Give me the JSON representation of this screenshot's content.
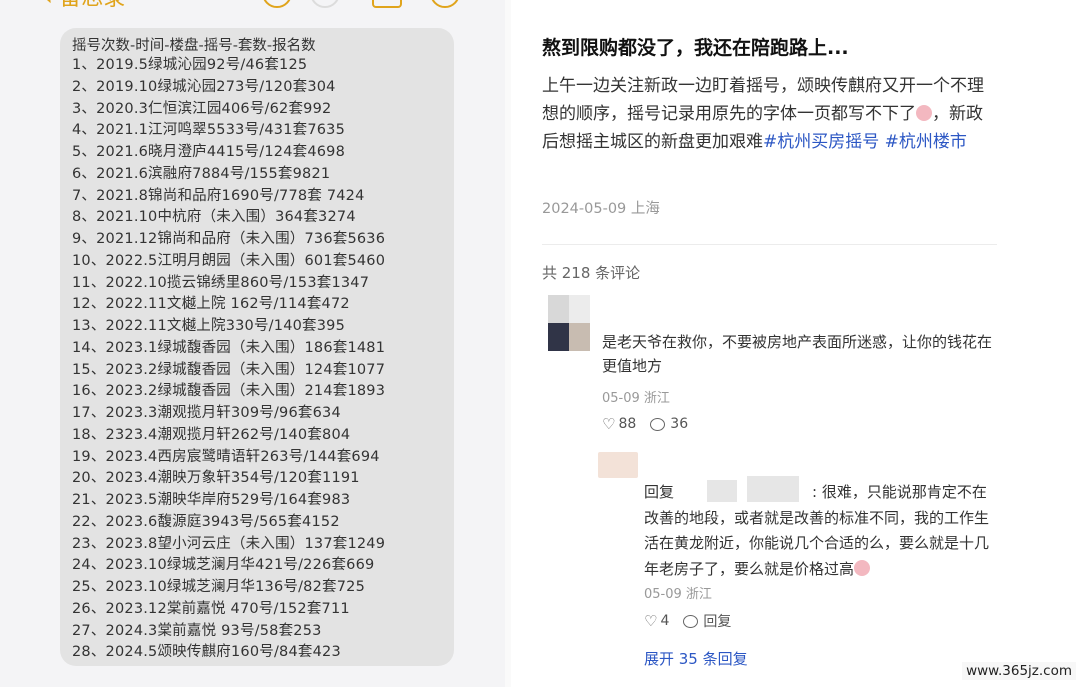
{
  "left_app": {
    "back_label": "备忘录",
    "note": {
      "header": "摇号次数-时间-楼盘-摇号-套数-报名数",
      "lines": [
        "1、2019.5绿城沁园92号/46套125",
        "2、2019.10绿城沁园273号/120套304",
        "3、2020.3仁恒滨江园406号/62套992",
        "4、2021.1江河鸣翠5533号/431套7635",
        "5、2021.6晓月澄庐4415号/124套4698",
        "6、2021.6滨融府7884号/155套9821",
        "7、2021.8锦尚和品府1690号/778套 7424",
        "8、2021.10中杭府（未入围）364套3274",
        "9、2021.12锦尚和品府（未入围）736套5636",
        "10、2022.5江明月朗园（未入围）601套5460",
        "11、2022.10揽云锦绣里860号/153套1347",
        "12、2022.11文樾上院 162号/114套472",
        "13、2022.11文樾上院330号/140套395",
        "14、2023.1绿城馥香园（未入围）186套1481",
        "15、2023.2绿城馥香园（未入围）124套1077",
        "16、2023.2绿城馥香园（未入围）214套1893",
        "17、2023.3潮观揽月轩309号/96套634",
        "18、2323.4潮观揽月轩262号/140套804",
        "19、2023.4西房宸鹭晴语轩263号/144套694",
        "20、2023.4潮映万象轩354号/120套1191",
        "21、2023.5潮映华岸府529号/164套983",
        "22、2023.6馥源庭3943号/565套4152",
        "23、2023.8望小河云庄（未入围）137套1249",
        "24、2023.10绿城芝澜月华421号/226套669",
        "25、2023.10绿城芝澜月华136号/82套725",
        "26、2023.12棠前嘉悦 470号/152套711",
        "27、2024.3棠前嘉悦 93号/58套253",
        "28、2024.5颂映传麒府160号/84套423"
      ]
    },
    "accent_color": "#e0a41c"
  },
  "post": {
    "title": "熬到限购都没了，我还在陪跑路上...",
    "body_text": "上午一边关注新政一边盯着摇号，颂映传麒府又开一个不理想的顺序，摇号记录用原先的字体一页都写不下了",
    "body_text_2": "，新政后想摇主城区的新盘更加艰难",
    "hashtags": [
      "#杭州买房摇号",
      "#杭州楼市"
    ],
    "date": "2024-05-09",
    "location": "上海"
  },
  "comments": {
    "count_label": "共 218 条评论",
    "items": [
      {
        "text": "是老天爷在救你，不要被房地产表面所迷惑，让你的钱花在更值地方",
        "date": "05-09",
        "location": "浙江",
        "likes": "88",
        "replies": "36"
      }
    ],
    "reply": {
      "prefix": "回复",
      "separator": ":",
      "text": "很难，只能说那肯定不在改善的地段，或者就是改善的标准不同，我的工作生活在黄龙附近，你能说几个合适的么，要么就是十几年老房子了，要么就是价格过高",
      "date": "05-09",
      "location": "浙江",
      "likes": "4",
      "reply_label": "回复"
    },
    "expand_label": "展开 35 条回复"
  },
  "watermark": "www.365jz.com",
  "link_color": "#2c57c4"
}
